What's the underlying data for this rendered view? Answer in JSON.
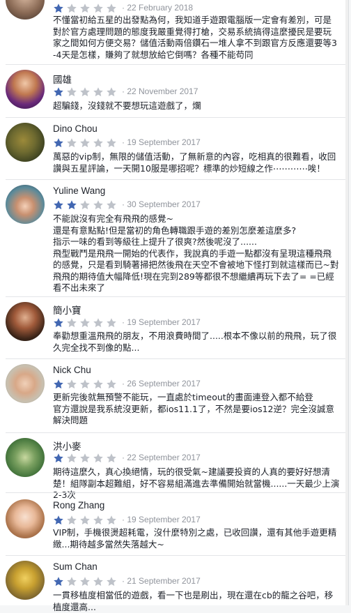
{
  "colors": {
    "star_filled": "#4267b2",
    "star_empty": "#bec2c9",
    "text": "#1d2129",
    "muted": "#90949c"
  },
  "reviews": [
    {
      "name": "",
      "rating": 1,
      "date": "· 22 February 2018",
      "text": "不懂當初給五星的出發點為何，我知道手遊跟電腦版一定會有差別，可是對於官方處理問題的態度我嚴重覺得打槍，交易系統搞得這麼擾民是要玩家之間如何方便交易？儲值活動兩倍鑽石一堆人拿不到跟官方反應還要等3-4天是怎樣，賺夠了就想放給它倒嗎？各種不能苟同"
    },
    {
      "name": "國雄",
      "rating": 1,
      "date": "· 22 November 2017",
      "text": "超騙錢，沒錢就不要想玩這遊戲了，爛"
    },
    {
      "name": "Dino Chou",
      "rating": 1,
      "date": "· 19 September 2017",
      "text": "萬惡的vip制，無限的儲值活動，了無新意的內容，吃相真的很難看，收回讚與五星評論，一天開10服是哪招呢？標準的炒短線之作⋯⋯⋯⋯唉！"
    },
    {
      "name": "Yuline Wang",
      "rating": 2,
      "date": "· 30 September 2017",
      "text": "不能說沒有完全有飛飛的感覺~\n還是有意點點!但是當初的角色轉職跟手遊的差別怎麼差這麼多?\n指示一味的看到等級往上提升了很爽?然後呢沒了......\n飛型戰鬥是飛飛一開始的代表作，我說真的手遊一點都沒有呈現這種飛飛的感覺，只是看到騎著掃把然後飛在天空不會被地下怪打到就這樣而已~對飛飛的期待值大幅降低!現在完到289等都很不想繼續再玩下去了= =已經看不出未來了"
    },
    {
      "name": "簡小寶",
      "rating": 1,
      "date": "· 19 September 2017",
      "text": "奉勸想重溫飛飛的朋友，不用浪費時間了.....根本不像以前的飛飛，玩了很久完全找不到像的點..."
    },
    {
      "name": "Nick Chu",
      "rating": 1,
      "date": "· 26 September 2017",
      "text": "更新完後就無預警不能玩，一直處於timeout的畫面連登入都不給登\n官方還說是我系統沒更新，都ios11.1了，不然是要ios12逆？完全沒誠意解決問題"
    },
    {
      "name": "洪小麥",
      "rating": 1,
      "date": "· 22 September 2017",
      "text": "期待這麼久，真心換絕情，玩的很受氣~建議要投資的人真的要好好想清楚！組隊副本超難組，好不容易組滿進去準備開始就當機......一天最少上演2-3次"
    },
    {
      "name": "Rong Zhang",
      "rating": 1,
      "date": "· 19 September 2017",
      "text": "VIP制，手機很燙超耗電，沒什麼特別之處，已收回讚，還有其他手遊更精緻...期待越多當然失落越大~"
    },
    {
      "name": "Sum Chan",
      "rating": 1,
      "date": "· 21 September 2017",
      "text": "一貫移植度相當低的遊戲，看一下也是刷出，現在還在cb的龍之谷吧，移植度還高..."
    }
  ]
}
